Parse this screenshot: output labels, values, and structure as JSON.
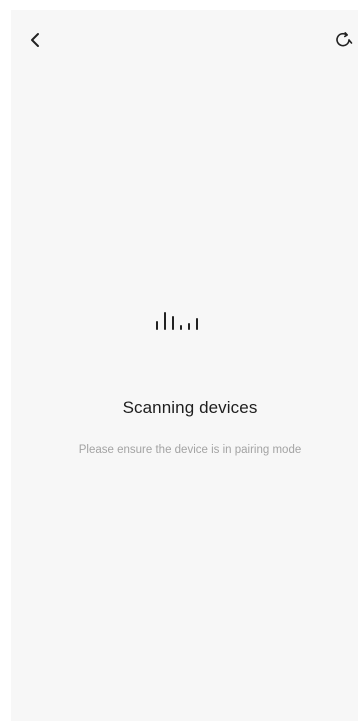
{
  "header": {
    "back_icon": "chevron-left-icon",
    "refresh_icon": "refresh-icon"
  },
  "scan": {
    "indicator_icon": "scanning-bars-icon",
    "title": "Scanning devices",
    "subtitle": "Please ensure the device is in pairing mode"
  },
  "colors": {
    "background": "#f7f7f7",
    "title_text": "#1e1e1e",
    "subtitle_text": "#a3a3a3",
    "icon": "#222222"
  }
}
